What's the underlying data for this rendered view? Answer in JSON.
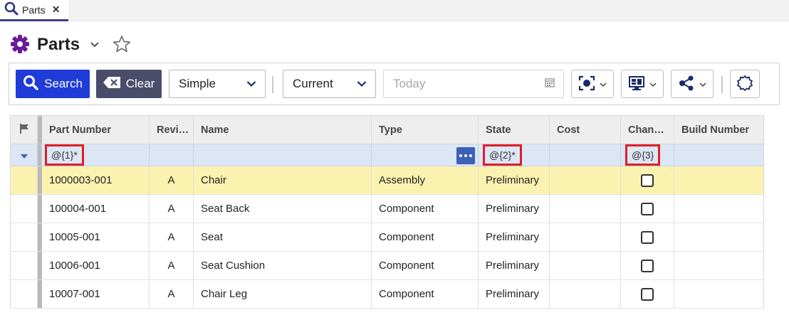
{
  "tab": {
    "label": "Parts",
    "close": "✕"
  },
  "title": "Parts",
  "toolbar": {
    "search_label": "Search",
    "clear_label": "Clear",
    "mode_value": "Simple",
    "version_value": "Current",
    "date_placeholder": "Today"
  },
  "grid": {
    "columns": [
      "Part Number",
      "Revi…",
      "Name",
      "Type",
      "State",
      "Cost",
      "Chan…",
      "Build Number"
    ],
    "filters": {
      "part_number": "@{1}*",
      "state": "@{2}*",
      "changes": "@{3}"
    },
    "rows": [
      {
        "part_number": "1000003-001",
        "revision": "A",
        "name": "Chair",
        "type": "Assembly",
        "state": "Preliminary"
      },
      {
        "part_number": "100004-001",
        "revision": "A",
        "name": "Seat Back",
        "type": "Component",
        "state": "Preliminary"
      },
      {
        "part_number": "10005-001",
        "revision": "A",
        "name": "Seat",
        "type": "Component",
        "state": "Preliminary"
      },
      {
        "part_number": "10006-001",
        "revision": "A",
        "name": "Seat Cushion",
        "type": "Component",
        "state": "Preliminary"
      },
      {
        "part_number": "10007-001",
        "revision": "A",
        "name": "Chair Leg",
        "type": "Component",
        "state": "Preliminary"
      }
    ]
  },
  "colors": {
    "accent_blue": "#1f3bd8",
    "clear_button": "#4a4d6a",
    "gear_purple": "#6a1b9a",
    "selected_row": "#fbf2b0",
    "filter_row": "#dce6f5",
    "highlight_red": "#dd1f27"
  }
}
